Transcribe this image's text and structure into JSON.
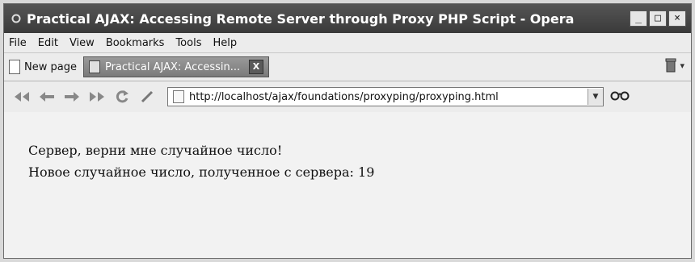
{
  "window": {
    "title": "Practical AJAX: Accessing Remote Server through Proxy PHP Script - Opera",
    "controls": {
      "minimize": "_",
      "maximize": "□",
      "close": "×"
    }
  },
  "menu": [
    "File",
    "Edit",
    "View",
    "Bookmarks",
    "Tools",
    "Help"
  ],
  "tabs": {
    "new_page": "New page",
    "active_tab": "Practical AJAX: Accessin...",
    "close": "X"
  },
  "toolbar": {
    "address": "http://localhost/ajax/foundations/proxyping/proxyping.html",
    "icons": [
      "rewind-icon",
      "back-icon",
      "forward-icon",
      "fast-forward-icon",
      "reload-icon",
      "edit-icon",
      "page-icon",
      "dropdown-icon",
      "glasses-icon",
      "trash-icon"
    ]
  },
  "page": {
    "line1": "Сервер, верни мне случайное число!",
    "line2": "Новое случайное число, полученное с сервера: 19"
  },
  "colors": {
    "titlebar": "#3a3a3a",
    "tab": "#8a8a8a",
    "content_bg": "#f2f2f2"
  }
}
